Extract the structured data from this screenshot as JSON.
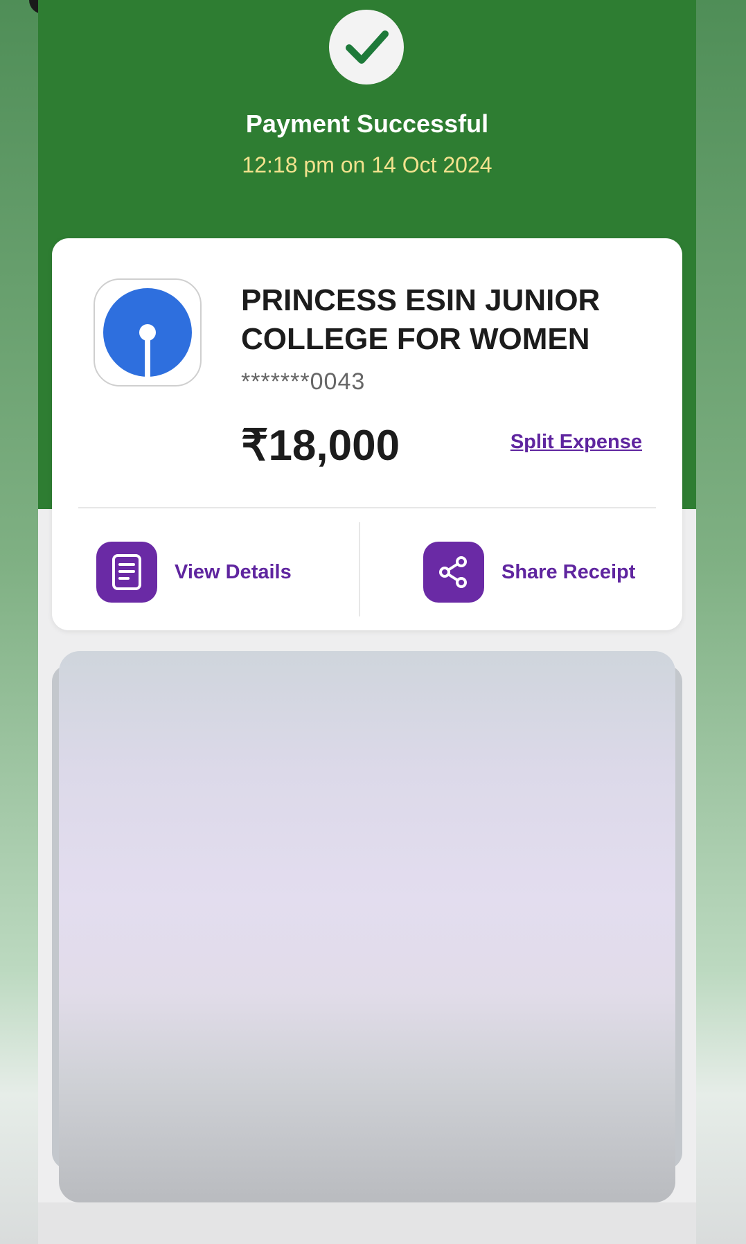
{
  "status": {
    "title": "Payment Successful",
    "timestamp": "12:18 pm on 14 Oct 2024"
  },
  "payee": {
    "name": "PRINCESS ESIN JUNIOR COLLEGE FOR WOMEN",
    "account_masked": "*******0043",
    "bank_icon": "sbi-bank-logo"
  },
  "payment": {
    "amount": "₹18,000",
    "split_label": "Split Expense"
  },
  "actions": {
    "view_details_label": "View Details",
    "share_receipt_label": "Share Receipt"
  },
  "colors": {
    "header_green": "#2e7d32",
    "accent_purple": "#5f259f",
    "timestamp_yellow": "#f3e28e",
    "bank_blue": "#2e6fde"
  }
}
